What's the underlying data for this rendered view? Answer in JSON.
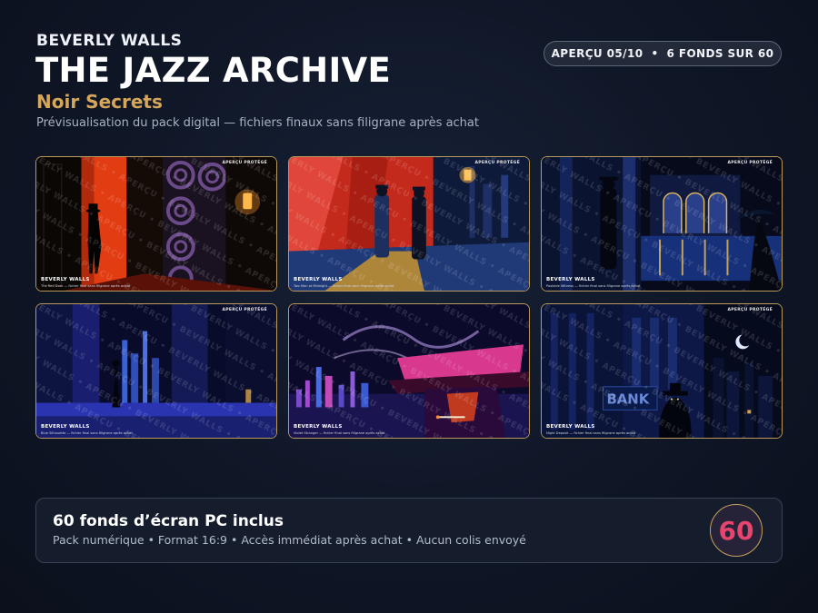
{
  "header": {
    "brand": "BEVERLY WALLS",
    "title": "THE JAZZ ARCHIVE",
    "subtitle": "Noir Secrets",
    "description": "Prévisualisation du pack digital — fichiers finaux sans filigrane après achat"
  },
  "badge": {
    "preview": "APERÇU 05/10",
    "separator": "•",
    "count": "6 FONDS SUR 60"
  },
  "watermark_text": "BEVERLY WALLS • APERÇU • BEVERLY WALLS • APERÇU • BEVERLY WALLS • APERÇU",
  "cards": [
    {
      "tag": "APERÇU PROTÉGÉ",
      "brand": "BEVERLY WALLS",
      "caption": "The Red Door — fichier final sans filigrane après achat"
    },
    {
      "tag": "APERÇU PROTÉGÉ",
      "brand": "BEVERLY WALLS",
      "caption": "Two Men at Midnight — fichier final sans filigrane après achat"
    },
    {
      "tag": "APERÇU PROTÉGÉ",
      "brand": "BEVERLY WALLS",
      "caption": "Poolside Witness — fichier final sans filigrane après achat"
    },
    {
      "tag": "APERÇU PROTÉGÉ",
      "brand": "BEVERLY WALLS",
      "caption": "Blue Silhouette — fichier final sans filigrane après achat"
    },
    {
      "tag": "APERÇU PROTÉGÉ",
      "brand": "BEVERLY WALLS",
      "caption": "Violet Stranger — fichier final sans filigrane après achat"
    },
    {
      "tag": "APERÇU PROTÉGÉ",
      "brand": "BEVERLY WALLS",
      "caption": "Night Deposit — fichier final sans filigrane après achat"
    }
  ],
  "bank_sign": "BANK",
  "footer": {
    "title": "60 fonds d’écran PC inclus",
    "subtitle": "Pack numérique • Format 16:9 • Accès immédiat après achat • Aucun colis envoyé",
    "count": "60"
  },
  "colors": {
    "accent_gold": "#d6a65a",
    "count_pink": "#e8456e",
    "background": "#0f1626"
  }
}
